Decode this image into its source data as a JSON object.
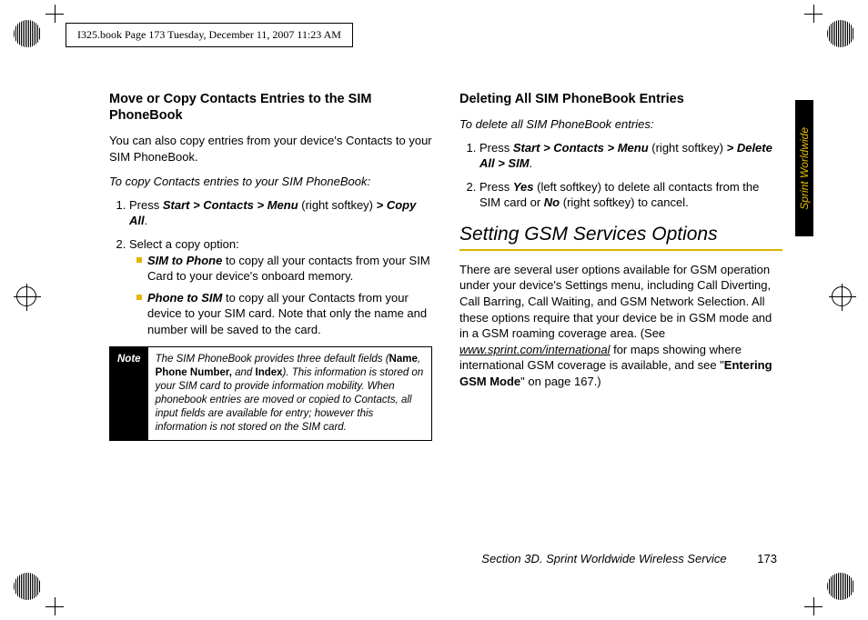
{
  "header": "I325.book  Page 173  Tuesday, December 11, 2007  11:23 AM",
  "tab": "Sprint Worldwide",
  "left": {
    "h1": "Move or Copy Contacts Entries to the SIM PhoneBook",
    "p1": "You can also copy entries from your device's Contacts to your SIM PhoneBook.",
    "instr": "To copy Contacts entries to your SIM PhoneBook:",
    "s1a": "Press ",
    "s1b": "Start > Contacts > Menu",
    "s1c": " (right softkey) ",
    "s1d": "> Copy All",
    "s1e": ".",
    "s2": "Select a copy option:",
    "sub1a": "SIM to Phone",
    "sub1b": " to copy all your contacts from your SIM Card to your device's onboard memory.",
    "sub2a": "Phone to SIM",
    "sub2b": " to copy all your Contacts from your device to your SIM card. Note that only the name and number will be saved to the card.",
    "noteLabel": "Note",
    "note_a": "The SIM PhoneBook provides three default fields (",
    "note_b": "Name",
    "note_c": ", ",
    "note_d": "Phone Number,",
    "note_e": " and ",
    "note_f": "Index",
    "note_g": "). This information is stored on your SIM card to provide information mobility. When phonebook entries are moved or copied to Contacts, all input fields are available for entry; however this information is not stored on the SIM card."
  },
  "right": {
    "h1": "Deleting All SIM PhoneBook Entries",
    "instr": "To delete all SIM PhoneBook entries:",
    "s1a": "Press ",
    "s1b": "Start > Contacts > Menu",
    "s1c": " (right softkey) ",
    "s1d": "> Delete All > SIM",
    "s1e": ".",
    "s2a": "Press ",
    "s2b": "Yes",
    "s2c": " (left softkey) to delete all contacts from the SIM card or ",
    "s2d": "No",
    "s2e": " (right softkey) to cancel.",
    "h2": "Setting GSM Services Options",
    "p1a": "There are several user options available for GSM operation under your device's Settings menu, including Call Diverting, Call Barring, Call Waiting, and GSM Network Selection. All these options require that your device be in GSM mode and in a GSM roaming coverage area. (See ",
    "p1link": "www.sprint.com/international",
    "p1b": " for maps showing where international GSM coverage is available, and see \"",
    "p1bold": "Entering GSM Mode",
    "p1c": "\" on page 167.)"
  },
  "footer": {
    "section": "Section 3D. Sprint Worldwide Wireless Service",
    "page": "173"
  }
}
